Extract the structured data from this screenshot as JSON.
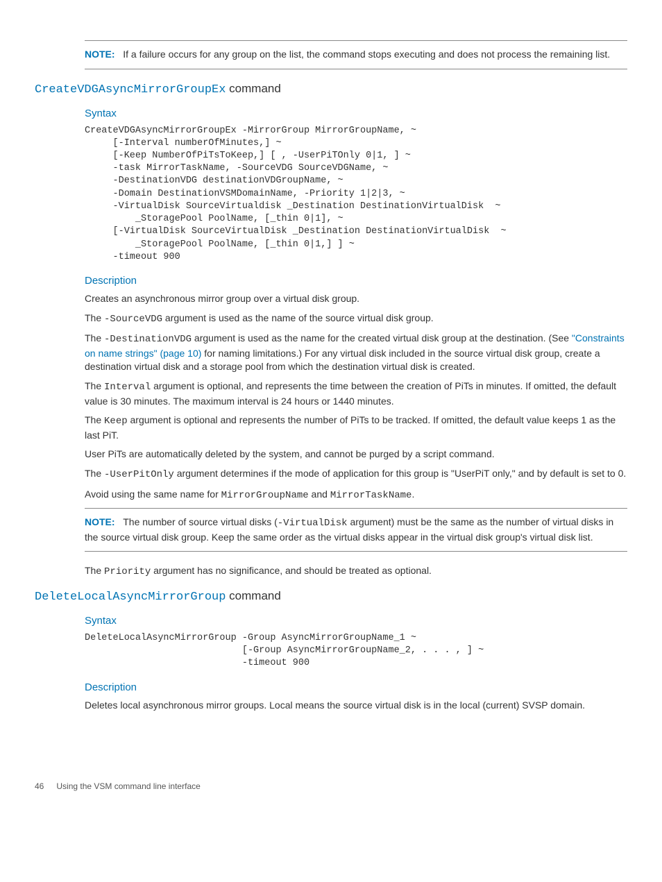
{
  "note1": {
    "label": "NOTE:",
    "text": "If a failure occurs for any group on the list, the command stops executing and does not process the remaining list."
  },
  "section1": {
    "cmd": "CreateVDGAsyncMirrorGroupEx",
    "suffix": " command",
    "syntax_label": "Syntax",
    "syntax_code": "CreateVDGAsyncMirrorGroupEx -MirrorGroup MirrorGroupName, ~\n     [-Interval numberOfMinutes,] ~\n     [-Keep NumberOfPiTsToKeep,] [ , -UserPiTOnly 0|1, ] ~\n     -task MirrorTaskName, -SourceVDG SourceVDGName, ~\n     -DestinationVDG destinationVDGroupName, ~\n     -Domain DestinationVSMDomainName, -Priority 1|2|3, ~\n     -VirtualDisk SourceVirtualdisk _Destination DestinationVirtualDisk  ~\n         _StoragePool PoolName, [_thin 0|1], ~\n     [-VirtualDisk SourceVirtualDisk _Destination DestinationVirtualDisk  ~\n         _StoragePool PoolName, [_thin 0|1,] ] ~\n     -timeout 900",
    "desc_label": "Description",
    "p1": "Creates an asynchronous mirror group over a virtual disk group.",
    "p2_a": "The ",
    "p2_code": "-SourceVDG",
    "p2_b": " argument is used as the name of the source virtual disk group.",
    "p3_a": "The ",
    "p3_code": "-DestinationVDG",
    "p3_b": " argument is used as the name for the created virtual disk group at the destination. (See ",
    "p3_link": "\"Constraints on name strings\" (page 10)",
    "p3_c": " for naming limitations.) For any virtual disk included in the source virtual disk group, create a destination virtual disk and a storage pool from which the destination virtual disk is created.",
    "p4_a": "The ",
    "p4_code": "Interval",
    "p4_b": " argument is optional, and represents the time between the creation of PiTs in minutes. If omitted, the default value is 30 minutes. The maximum interval is 24 hours or 1440 minutes.",
    "p5_a": "The ",
    "p5_code": "Keep",
    "p5_b": " argument is optional and represents the number of PiTs to be tracked. If omitted, the default value keeps 1 as the last PiT.",
    "p6": "User PiTs are automatically deleted by the system, and cannot be purged by a script command.",
    "p7_a": "The ",
    "p7_code": "-UserPitOnly",
    "p7_b": " argument determines if the mode of application for this group is \"UserPiT only,\" and by default is set to 0.",
    "p8_a": "Avoid using the same name for ",
    "p8_code1": "MirrorGroupName",
    "p8_mid": " and ",
    "p8_code2": "MirrorTaskName",
    "p8_end": "."
  },
  "note2": {
    "label": "NOTE:",
    "text_a": "The number of source virtual disks (",
    "text_code": "-VirtualDisk",
    "text_b": " argument) must be the same as the number of virtual disks in the source virtual disk group. Keep the same order as the virtual disks appear in the virtual disk group's virtual disk list."
  },
  "p9_a": "The ",
  "p9_code": "Priority",
  "p9_b": " argument has no significance, and should be treated as optional.",
  "section2": {
    "cmd": "DeleteLocalAsyncMirrorGroup",
    "suffix": " command",
    "syntax_label": "Syntax",
    "syntax_code": "DeleteLocalAsyncMirrorGroup -Group AsyncMirrorGroupName_1 ~\n                            [-Group AsyncMirrorGroupName_2, . . . , ] ~\n                            -timeout 900",
    "desc_label": "Description",
    "p1": "Deletes local asynchronous mirror groups. Local means the source virtual disk is in the local (current) SVSP domain."
  },
  "footer": {
    "page": "46",
    "title": "Using the VSM command line interface"
  }
}
